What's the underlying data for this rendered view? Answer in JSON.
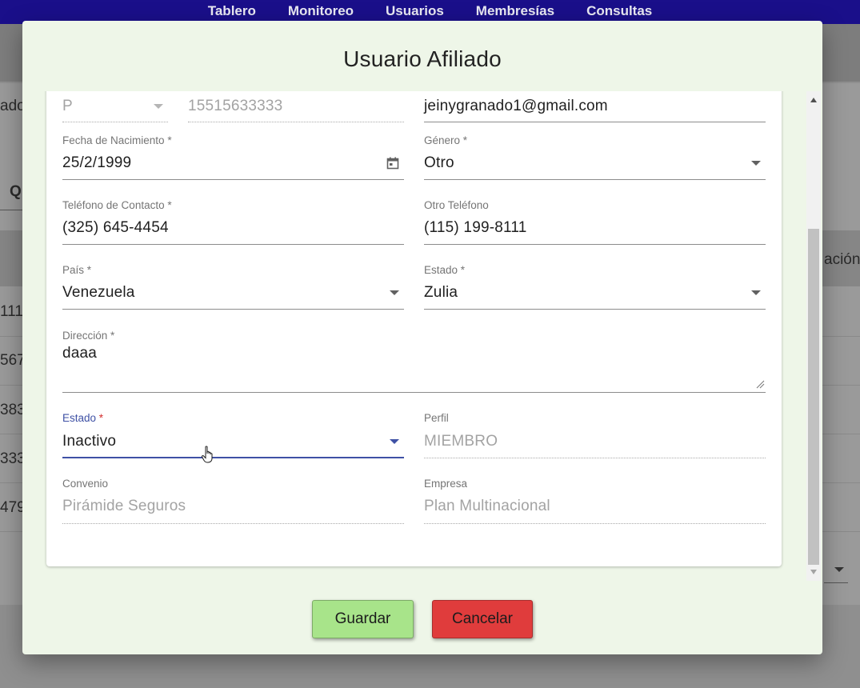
{
  "nav": {
    "items": [
      "Tablero",
      "Monitoreo",
      "Usuarios",
      "Membresías",
      "Consultas"
    ]
  },
  "background": {
    "left_fragment": "ado",
    "search_fragment": "Q",
    "header_fragment": "ación",
    "row_fragments": [
      "111",
      "567",
      "383",
      "333",
      "479"
    ]
  },
  "modal": {
    "title": "Usuario Afiliado",
    "form": {
      "doc_type": {
        "value": "P"
      },
      "doc_number": {
        "value": "15515633333"
      },
      "email": {
        "value": "jeinygranado1@gmail.com"
      },
      "birth_date": {
        "label": "Fecha de Nacimiento *",
        "value": "25/2/1999"
      },
      "gender": {
        "label": "Género *",
        "value": "Otro"
      },
      "phone": {
        "label": "Teléfono de Contacto *",
        "value": "(325) 645-4454"
      },
      "other_phone": {
        "label": "Otro Teléfono",
        "value": "(115) 199-8111"
      },
      "country": {
        "label": "País *",
        "value": "Venezuela"
      },
      "state": {
        "label": "Estado *",
        "value": "Zulia"
      },
      "address": {
        "label": "Dirección *",
        "value": "daaa"
      },
      "status": {
        "label": "Estado",
        "required_mark": "*",
        "value": "Inactivo"
      },
      "profile": {
        "label": "Perfil",
        "value": "MIEMBRO"
      },
      "agreement": {
        "label": "Convenio",
        "value": "Pirámide Seguros"
      },
      "company": {
        "label": "Empresa",
        "value": "Plan Multinacional"
      }
    },
    "buttons": {
      "save": "Guardar",
      "cancel": "Cancelar"
    }
  },
  "colors": {
    "nav_bg": "#1a0f8a",
    "modal_bg": "#eef6e8",
    "focus_accent": "#3f51a5",
    "save_bg": "#a8e48a",
    "cancel_bg": "#e03c3c"
  }
}
